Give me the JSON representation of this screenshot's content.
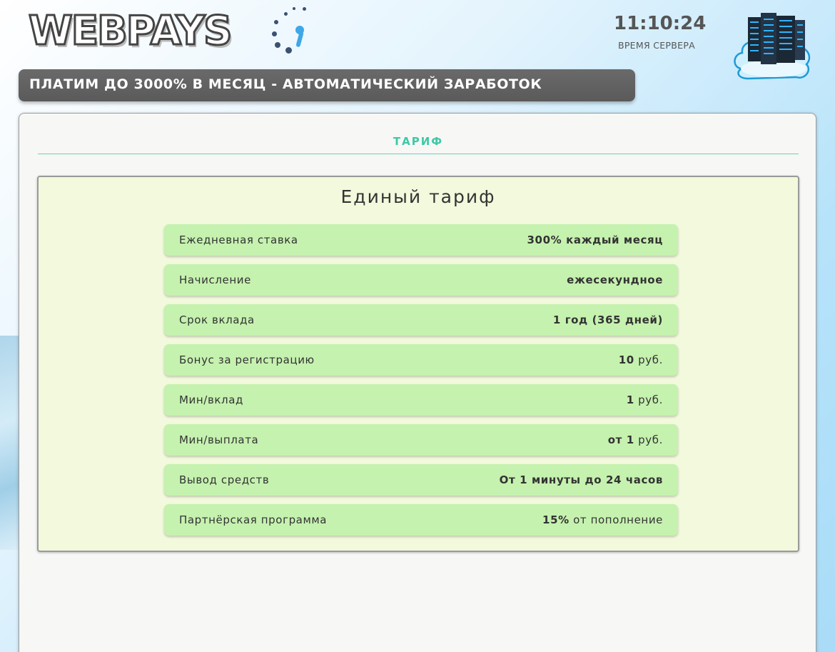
{
  "header": {
    "logo_text": "WEBPAYS",
    "server_time": "11:10:24",
    "server_time_label": "ВРЕМЯ СЕРВЕРА"
  },
  "slogan": "ПЛАТИМ ДО 3000% В МЕСЯЦ - АВТОМАТИЧЕСКИЙ ЗАРАБОТОК",
  "section": {
    "title": "ТАРИФ"
  },
  "tariff": {
    "title": "Единый тариф",
    "rows": [
      {
        "label": "Ежедневная ставка",
        "value": "300% каждый месяц",
        "unit": ""
      },
      {
        "label": "Начисление",
        "value": "ежесекундное",
        "unit": ""
      },
      {
        "label": "Срок вклада",
        "value": "1 год (365 дней)",
        "unit": ""
      },
      {
        "label": "Бонус за регистрацию",
        "value": "10",
        "unit": " руб."
      },
      {
        "label": "Мин/вклад",
        "value": "1",
        "unit": " руб."
      },
      {
        "label": "Мин/выплата",
        "value": "от 1",
        "unit": " руб."
      },
      {
        "label": "Вывод средств",
        "value": "От 1 минуты до 24 часов",
        "unit": ""
      },
      {
        "label": "Партнёрская программа",
        "value": "15%",
        "unit": " от пополнение"
      }
    ]
  },
  "colors": {
    "accent": "#3dc9a5",
    "row_bg": "#c5f2af",
    "panel_bg": "#f2f9dc",
    "slogan_bg": "#5f5f5f"
  },
  "icons": [
    "loading-spinner-icon",
    "server-cloud-icon"
  ]
}
